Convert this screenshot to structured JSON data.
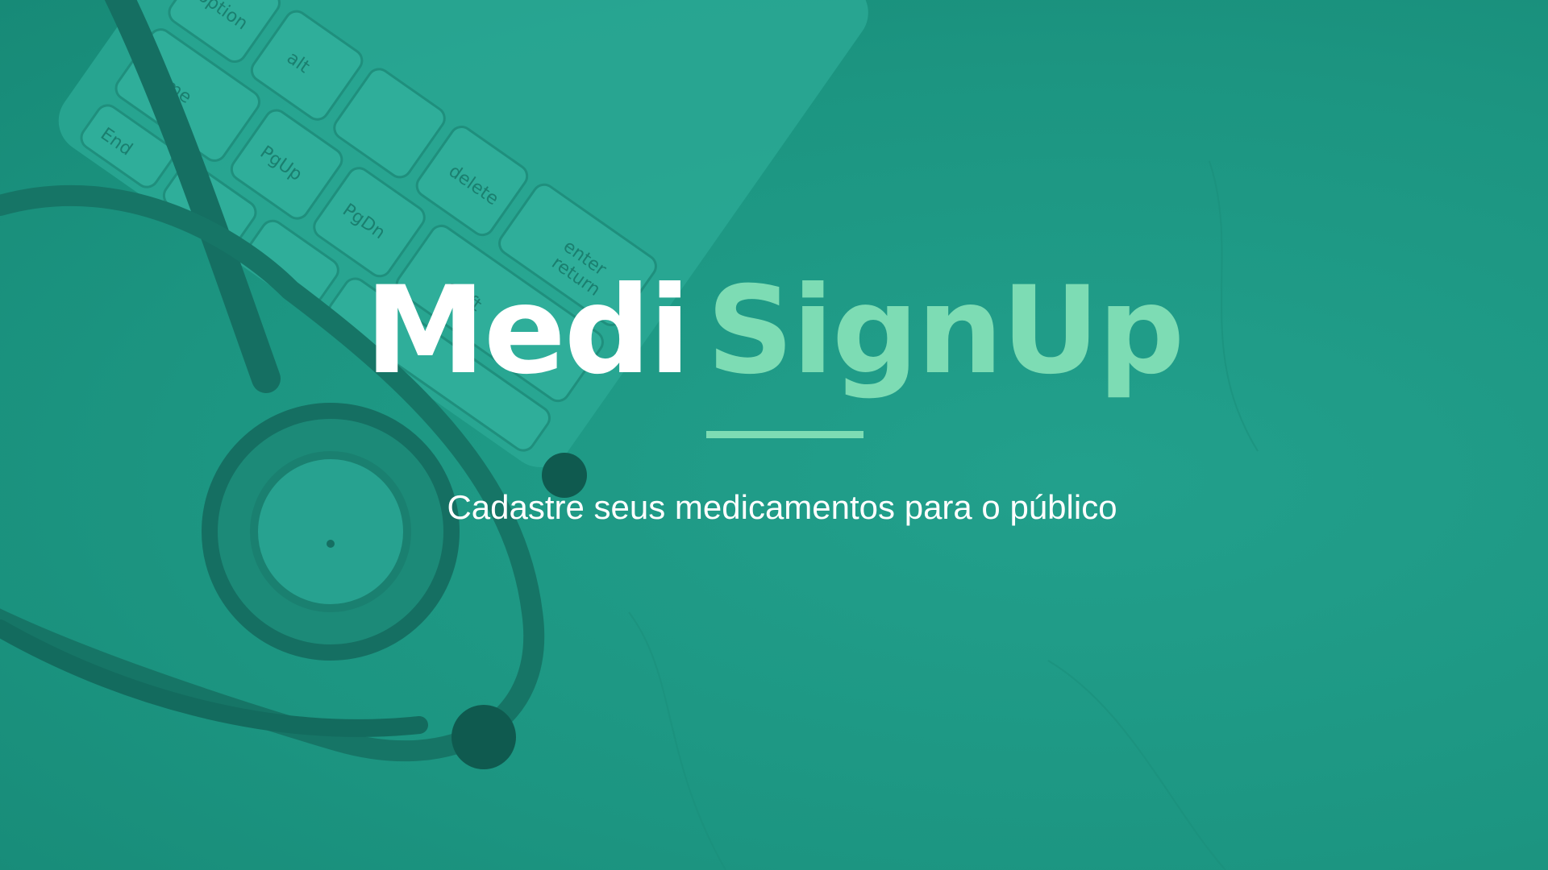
{
  "brand": {
    "name_part1": "Medi",
    "name_part2": "SignUp",
    "tagline": "Cadastre seus medicamentos para o público"
  },
  "keyboard": {
    "keys": [
      "option",
      "alt",
      "Home",
      "PgUp",
      "PgDn",
      "End",
      "enter",
      "return",
      "shift",
      "delete"
    ]
  },
  "colors": {
    "background": "#1f9a87",
    "accent": "#7ddcb4",
    "primary_text": "#ffffff"
  },
  "background_image": {
    "icons": [
      "keyboard-image",
      "stethoscope-image"
    ]
  }
}
